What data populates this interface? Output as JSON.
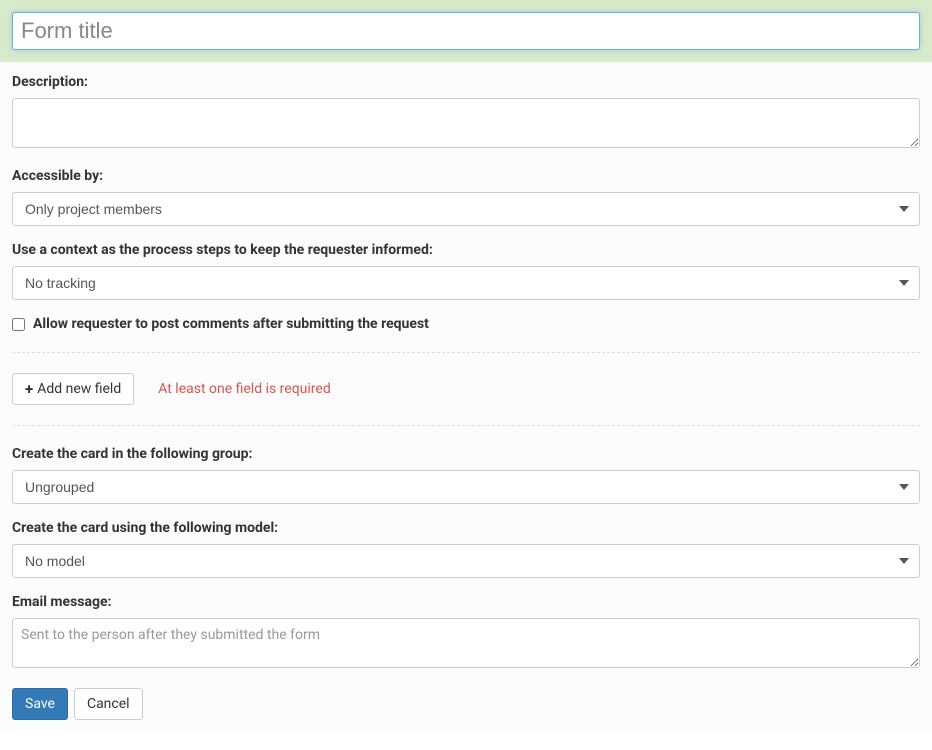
{
  "title": {
    "placeholder": "Form title",
    "value": ""
  },
  "description": {
    "label": "Description:",
    "value": ""
  },
  "accessible_by": {
    "label": "Accessible by:",
    "selected": "Only project members"
  },
  "context_tracking": {
    "label": "Use a context as the process steps to keep the requester informed:",
    "selected": "No tracking"
  },
  "allow_comments": {
    "label": "Allow requester to post comments after submitting the request",
    "checked": false
  },
  "add_field": {
    "button_label": "Add new field",
    "error_message": "At least one field is required"
  },
  "card_group": {
    "label": "Create the card in the following group:",
    "selected": "Ungrouped"
  },
  "card_model": {
    "label": "Create the card using the following model:",
    "selected": "No model"
  },
  "email_message": {
    "label": "Email message:",
    "placeholder": "Sent to the person after they submitted the form",
    "value": ""
  },
  "actions": {
    "save": "Save",
    "cancel": "Cancel"
  }
}
